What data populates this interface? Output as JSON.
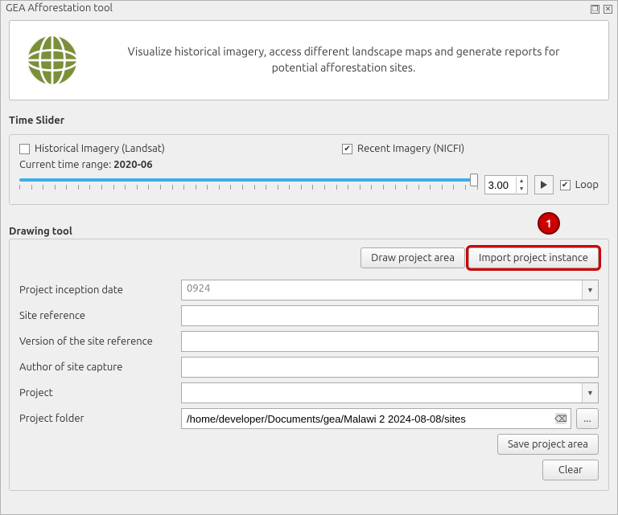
{
  "window": {
    "title": "GEA Afforestation tool"
  },
  "header": {
    "description": "Visualize historical imagery, access different landscape maps and generate reports for potential afforestation sites."
  },
  "time_slider": {
    "section_label": "Time Slider",
    "historical_label": "Historical Imagery (Landsat)",
    "historical_checked": false,
    "recent_label": "Recent Imagery (NICFI)",
    "recent_checked": true,
    "current_range_prefix": "Current time range: ",
    "current_range_value": "2020-06",
    "speed_value": "3.00",
    "loop_label": "Loop",
    "loop_checked": true
  },
  "drawing": {
    "section_label": "Drawing tool",
    "annotation_number": "1",
    "draw_btn": "Draw project area",
    "import_btn": "Import project instance",
    "fields": {
      "inception_label": "Project inception date",
      "inception_value": "0924",
      "site_ref_label": "Site reference",
      "site_ref_value": "",
      "version_label": "Version of the site reference",
      "version_value": "",
      "author_label": "Author of site capture",
      "author_value": "",
      "project_label": "Project",
      "project_value": "",
      "folder_label": "Project folder",
      "folder_value": "/home/developer/Documents/gea/Malawi 2 2024-08-08/sites",
      "browse_label": "..."
    },
    "save_btn": "Save project area",
    "clear_btn": "Clear"
  }
}
